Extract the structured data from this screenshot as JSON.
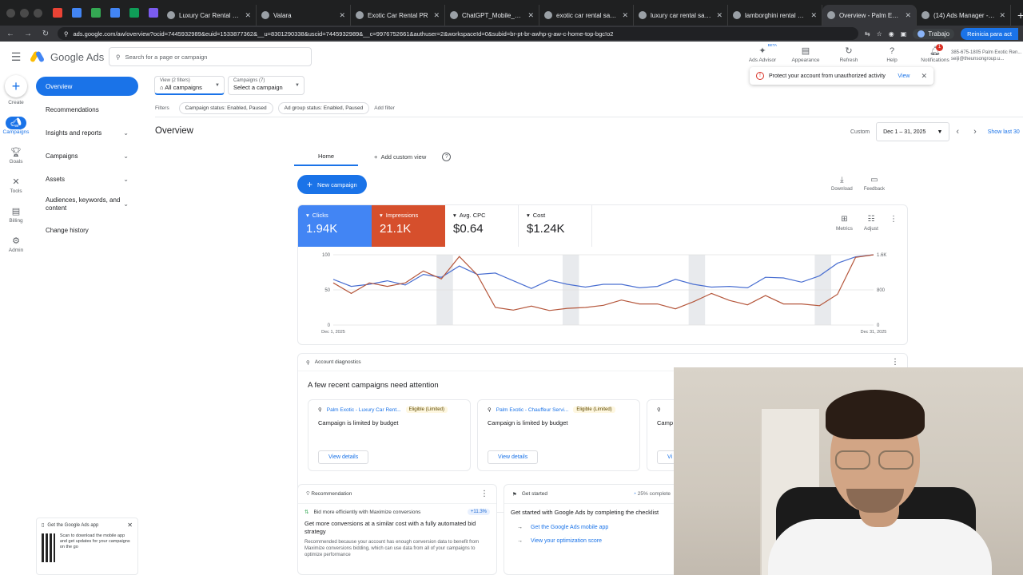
{
  "browser": {
    "tabs": [
      {
        "label": "Luxury Car Rental Puerto Ri...",
        "active": false
      },
      {
        "label": "Valara",
        "active": false
      },
      {
        "label": "Exotic Car Rental PR",
        "active": false
      },
      {
        "label": "ChatGPT_Mobile_Gerardo.p...",
        "active": false
      },
      {
        "label": "exotic car rental san juan - G...",
        "active": false
      },
      {
        "label": "luxury car rental san juan - G...",
        "active": false
      },
      {
        "label": "lamborghini rental puerto ric...",
        "active": false
      },
      {
        "label": "Overview - Palm Exotic Rent...",
        "active": true
      },
      {
        "label": "(14) Ads Manager - Manage...",
        "active": false
      }
    ],
    "url": "ads.google.com/aw/overview?ocid=7445932989&euid=1533877362&__u=8301290338&uscid=7445932989&__c=9976752661&authuser=2&workspaceId=0&subid=br-pt-br-awhp-g-aw-c-home-top-bgc!o2",
    "profile_label": "Trabajo",
    "restart_label": "Reinicia para act"
  },
  "app": {
    "logo_text": "Google Ads",
    "search_placeholder": "Search for a page or campaign",
    "tools": [
      {
        "icon": "ads-advisor-icon",
        "label": "Ads Advisor",
        "beta": "BETA"
      },
      {
        "icon": "appearance-icon",
        "label": "Appearance"
      },
      {
        "icon": "refresh-icon",
        "label": "Refresh"
      },
      {
        "icon": "help-icon",
        "label": "Help"
      },
      {
        "icon": "bell-icon",
        "label": "Notifications",
        "badge": "1"
      }
    ],
    "account_line1": "385-675-1805 Palm Exotic Ren...",
    "account_line2": "seiji@theunsongroup.u..."
  },
  "rail": [
    {
      "icon": "plus-icon",
      "label": "Create"
    },
    {
      "icon": "campaigns-icon",
      "label": "Campaigns",
      "active": true
    },
    {
      "icon": "trophy-icon",
      "label": "Goals"
    },
    {
      "icon": "tools-icon",
      "label": "Tools"
    },
    {
      "icon": "billing-icon",
      "label": "Billing"
    },
    {
      "icon": "gear-icon",
      "label": "Admin"
    }
  ],
  "nav": [
    {
      "label": "Overview",
      "active": true,
      "chevron": false
    },
    {
      "label": "Recommendations",
      "chevron": false
    },
    {
      "label": "Insights and reports",
      "chevron": true
    },
    {
      "label": "Campaigns",
      "chevron": true
    },
    {
      "label": "Assets",
      "chevron": true
    },
    {
      "label": "Audiences, keywords, and content",
      "chevron": true
    },
    {
      "label": "Change history",
      "chevron": false
    }
  ],
  "filters": {
    "view_caption": "View (2 filters)",
    "view_value": "All campaigns",
    "campaign_caption": "Campaigns (7)",
    "campaign_value": "Select a campaign",
    "filters_label": "Filters",
    "chips": [
      "Campaign status: Enabled, Paused",
      "Ad group status: Enabled, Paused"
    ],
    "add_filter": "Add filter"
  },
  "overview": {
    "title": "Overview",
    "custom_label": "Custom",
    "date_range": "Dec 1 – 31, 2025",
    "show_last": "Show last 30",
    "tab_home": "Home",
    "tab_add": "Add custom view",
    "new_campaign": "New campaign",
    "download": "Download",
    "feedback": "Feedback"
  },
  "metrics": [
    {
      "label": "Clicks",
      "value": "1.94K",
      "color": "#4285f4"
    },
    {
      "label": "Impressions",
      "value": "21.1K",
      "color": "#d64f2c"
    },
    {
      "label": "Avg. CPC",
      "value": "$0.64"
    },
    {
      "label": "Cost",
      "value": "$1.24K"
    }
  ],
  "chart_tools": {
    "metrics": "Metrics",
    "adjust": "Adjust"
  },
  "chart_data": {
    "type": "line",
    "x": [
      "Dec 1",
      "Dec 2",
      "Dec 3",
      "Dec 4",
      "Dec 5",
      "Dec 6",
      "Dec 7",
      "Dec 8",
      "Dec 9",
      "Dec 10",
      "Dec 11",
      "Dec 12",
      "Dec 13",
      "Dec 14",
      "Dec 15",
      "Dec 16",
      "Dec 17",
      "Dec 18",
      "Dec 19",
      "Dec 20",
      "Dec 21",
      "Dec 22",
      "Dec 23",
      "Dec 24",
      "Dec 25",
      "Dec 26",
      "Dec 27",
      "Dec 28",
      "Dec 29",
      "Dec 30",
      "Dec 31"
    ],
    "x_tick_labels": [
      "Dec 1, 2025",
      "Dec 31, 2025"
    ],
    "y_left_ticks": [
      "0",
      "50",
      "100"
    ],
    "y_right_ticks": [
      "0",
      "800",
      "1.6K"
    ],
    "y_left_lim": [
      0,
      100
    ],
    "y_right_lim": [
      0,
      1600
    ],
    "series": [
      {
        "name": "Clicks",
        "axis": "left",
        "color": "#4a6fd1",
        "values": [
          65,
          55,
          58,
          63,
          57,
          72,
          68,
          84,
          72,
          74,
          63,
          52,
          64,
          58,
          54,
          58,
          58,
          53,
          55,
          65,
          58,
          54,
          55,
          53,
          68,
          67,
          61,
          70,
          88,
          97,
          100
        ]
      },
      {
        "name": "Impressions",
        "axis": "right",
        "color": "#b5573c",
        "values": [
          960,
          720,
          960,
          880,
          960,
          1230,
          1050,
          1560,
          1140,
          400,
          340,
          430,
          330,
          380,
          400,
          450,
          570,
          480,
          480,
          370,
          530,
          720,
          560,
          460,
          670,
          480,
          480,
          440,
          700,
          1540,
          1600
        ]
      }
    ],
    "shaded_bands": [
      [
        6,
        7
      ],
      [
        13,
        14
      ],
      [
        20,
        21
      ],
      [
        27,
        28
      ]
    ],
    "grid": true
  },
  "diagnostics": {
    "head": "Account diagnostics",
    "title": "A few recent campaigns need attention",
    "cards": [
      {
        "name": "Palm Exotic - Luxury Car Rent...",
        "status": "Eligible (Limited)",
        "desc": "Campaign is limited by budget",
        "button": "View details"
      },
      {
        "name": "Palm Exotic - Chauffeur Servi...",
        "status": "Eligible (Limited)",
        "desc": "Campaign is limited by budget",
        "button": "View details"
      },
      {
        "name": "",
        "status": "",
        "desc": "Camp",
        "button": "Vi"
      }
    ]
  },
  "recommendation": {
    "head": "Recommendation",
    "row_text": "Bid more efficiently with Maximize conversions",
    "row_pct": "+11.3%",
    "title": "Get more conversions at a similar cost with a fully automated bid strategy",
    "desc": "Recommended because your account has enough conversion data to benefit from Maximize conversions bidding, which can use data from all of your campaigns to optimize performance"
  },
  "get_started": {
    "head": "Get started",
    "progress": "25% complete",
    "title": "Get started with Google Ads by completing the checklist",
    "steps": [
      "Get the Google Ads mobile app",
      "View your optimization score"
    ]
  },
  "promo": {
    "head": "Get the Google Ads app",
    "text": "Scan to download the mobile app and get updates for your campaigns on the go"
  },
  "notice": {
    "text": "Protect your account from unauthorized activity",
    "view": "View"
  }
}
